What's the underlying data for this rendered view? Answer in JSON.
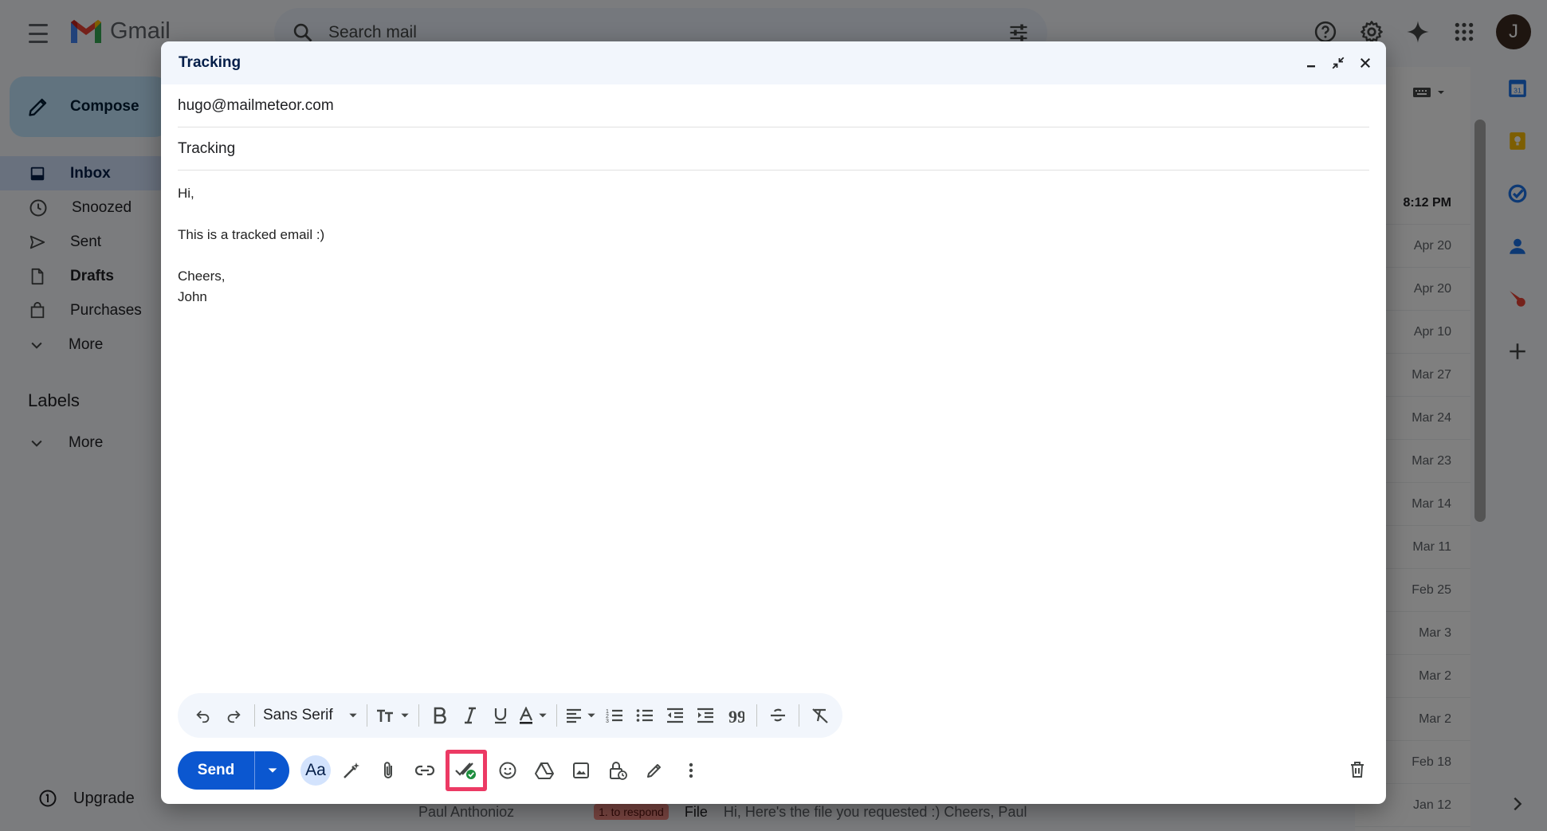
{
  "app": {
    "name": "Gmail",
    "search_placeholder": "Search mail",
    "avatar_initial": "J",
    "compose_label": "Compose",
    "upgrade_label": "Upgrade",
    "labels_heading": "Labels"
  },
  "nav": {
    "items": [
      {
        "label": "Inbox",
        "icon": "inbox-icon"
      },
      {
        "label": "Snoozed",
        "icon": "clock-icon"
      },
      {
        "label": "Sent",
        "icon": "send-icon"
      },
      {
        "label": "Drafts",
        "icon": "draft-icon"
      },
      {
        "label": "Purchases",
        "icon": "shopping-bag-icon"
      },
      {
        "label": "More",
        "icon": "chevron-down-icon"
      }
    ],
    "labels_more": "More"
  },
  "mail_list": {
    "dates": [
      "8:12 PM",
      "Apr 20",
      "Apr 20",
      "Apr 10",
      "Mar 27",
      "Mar 24",
      "Mar 23",
      "Mar 14",
      "Mar 11",
      "Feb 25",
      "Mar 3",
      "Mar 2",
      "Mar 2",
      "Feb 18",
      "Jan 12"
    ],
    "bottom_sender": "Paul Anthonioz",
    "bottom_label": "1. to respond",
    "bottom_subject": "File",
    "bottom_snippet": "Hi, Here's the file you requested :) Cheers, Paul"
  },
  "compose": {
    "title": "Tracking",
    "to": "hugo@mailmeteor.com",
    "subject": "Tracking",
    "body_lines": [
      "Hi,",
      "",
      "This is a tracked email :)",
      "",
      "Cheers,",
      "John"
    ],
    "font_name": "Sans Serif",
    "send_label": "Send",
    "aa_label": "Aa",
    "highlight_color": "#ec3a64",
    "send_color": "#0b57d0"
  }
}
